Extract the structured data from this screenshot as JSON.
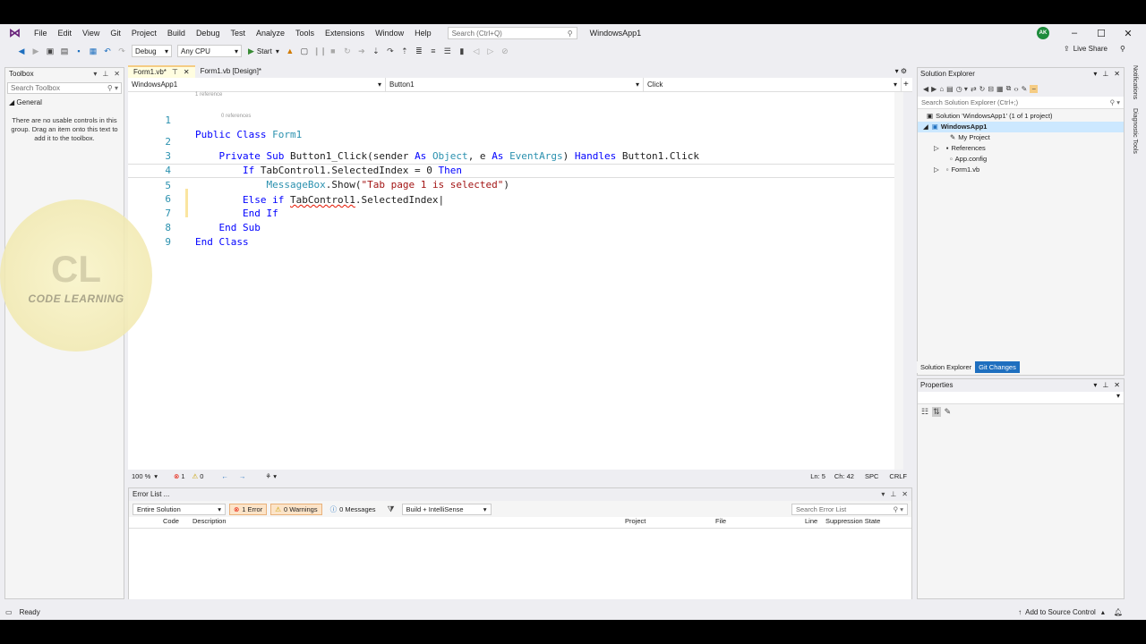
{
  "menu": [
    "File",
    "Edit",
    "View",
    "Git",
    "Project",
    "Build",
    "Debug",
    "Test",
    "Analyze",
    "Tools",
    "Extensions",
    "Window",
    "Help"
  ],
  "search": {
    "placeholder": "Search (Ctrl+Q)"
  },
  "solution_title": "WindowsApp1",
  "user_initials": "AK",
  "toolbar": {
    "config": "Debug",
    "platform": "Any CPU",
    "start": "Start",
    "live_share": "Live Share"
  },
  "toolbox": {
    "title": "Toolbox",
    "search_placeholder": "Search Toolbox",
    "group": "General",
    "message": "There are no usable controls in this group. Drag an item onto this text to add it to the toolbox."
  },
  "tabs": [
    {
      "label": "Form1.vb*"
    },
    {
      "label": "Form1.vb [Design]*"
    }
  ],
  "nav": {
    "project": "WindowsApp1",
    "object": "Button1",
    "event": "Click"
  },
  "editor": {
    "hint_ref1": "1 reference",
    "hint_ref0": "0 references",
    "line_numbers": [
      "1",
      "2",
      "3",
      "4",
      "5",
      "6",
      "7",
      "8",
      "9"
    ]
  },
  "editor_status": {
    "zoom": "100 %",
    "errors": "1",
    "warnings": "0",
    "ln": "Ln: 5",
    "ch": "Ch: 42",
    "spc": "SPC",
    "crlf": "CRLF"
  },
  "error_list": {
    "title": "Error List ...",
    "scope": "Entire Solution",
    "errors_btn": "1 Error",
    "warnings_btn": "0 Warnings",
    "messages_btn": "0 Messages",
    "build_filter": "Build + IntelliSense",
    "search_placeholder": "Search Error List",
    "columns": [
      "Code",
      "Description",
      "Project",
      "File",
      "Line",
      "Suppression State"
    ]
  },
  "solution_explorer": {
    "title": "Solution Explorer",
    "search_placeholder": "Search Solution Explorer (Ctrl+;)",
    "solution": "Solution 'WindowsApp1' (1 of 1 project)",
    "project": "WindowsApp1",
    "items": [
      "My Project",
      "References",
      "App.config",
      "Form1.vb"
    ],
    "bottom_tabs": [
      "Solution Explorer",
      "Git Changes"
    ]
  },
  "properties": {
    "title": "Properties"
  },
  "status": {
    "ready": "Ready",
    "source_control": "Add to Source Control"
  },
  "side_rail": {
    "notifications": "Notifications",
    "diagnostics": "Diagnostic Tools"
  },
  "watermark": {
    "text": "CODE LEARNING"
  }
}
